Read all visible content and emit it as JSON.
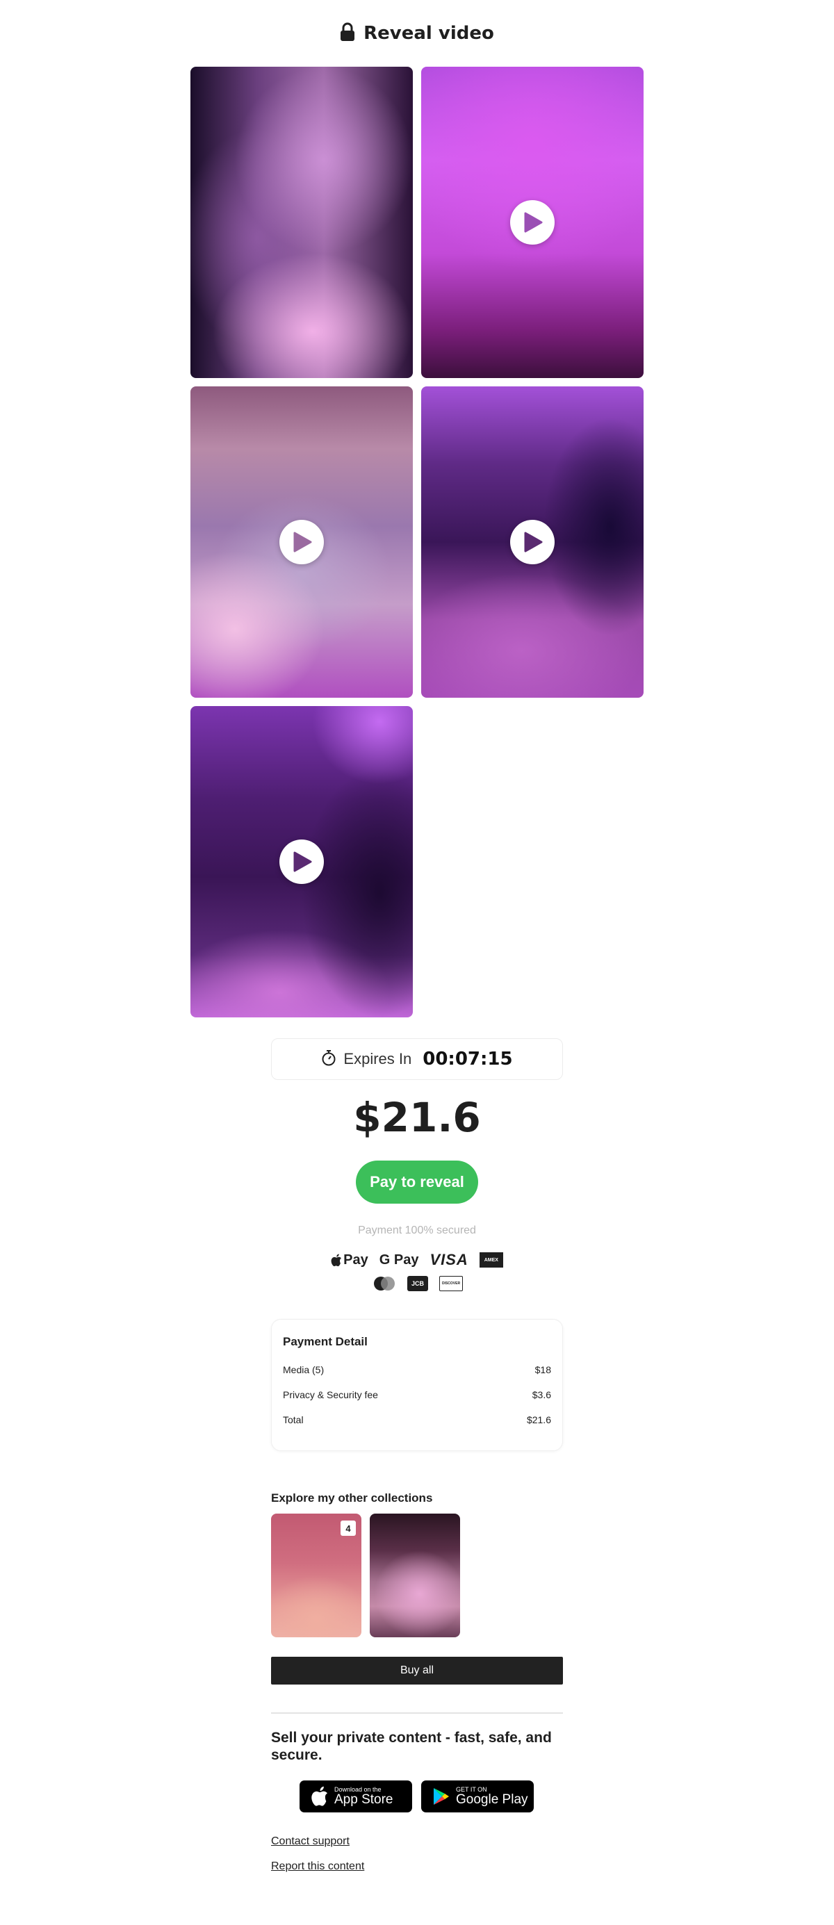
{
  "header": {
    "title": "Reveal video",
    "icon": "lock-icon"
  },
  "media": {
    "count": 5,
    "tiles": [
      {
        "has_play": false
      },
      {
        "has_play": true
      },
      {
        "has_play": true
      },
      {
        "has_play": true
      },
      {
        "has_play": true
      }
    ]
  },
  "timer": {
    "label": "Expires In",
    "value": "00:07:15",
    "icon": "stopwatch-icon"
  },
  "price": "$21.6",
  "pay_button": {
    "label": "Pay to reveal",
    "color": "#3cbf5a"
  },
  "secured_text": "Payment 100% secured",
  "payment_methods": {
    "apple_pay": "Pay",
    "google_pay": "G Pay",
    "visa": "VISA",
    "amex": "AMEX",
    "jcb": "JCB",
    "discover": "DISCOVER"
  },
  "payment_detail": {
    "title": "Payment Detail",
    "rows": [
      {
        "label": "Media (5)",
        "value": "$18"
      },
      {
        "label": "Privacy & Security fee",
        "value": "$3.6"
      },
      {
        "label": "Total",
        "value": "$21.6"
      }
    ]
  },
  "collections": {
    "title": "Explore my other collections",
    "items": [
      {
        "badge": "4"
      },
      {
        "badge": ""
      }
    ],
    "buy_all_label": "Buy all"
  },
  "promo": {
    "headline": "Sell your private content - fast, safe, and secure.",
    "app_store": {
      "small": "Download on the",
      "big": "App Store"
    },
    "google_play": {
      "small": "GET IT ON",
      "big": "Google Play"
    }
  },
  "links": {
    "contact_support": "Contact support",
    "report": "Report this content"
  }
}
